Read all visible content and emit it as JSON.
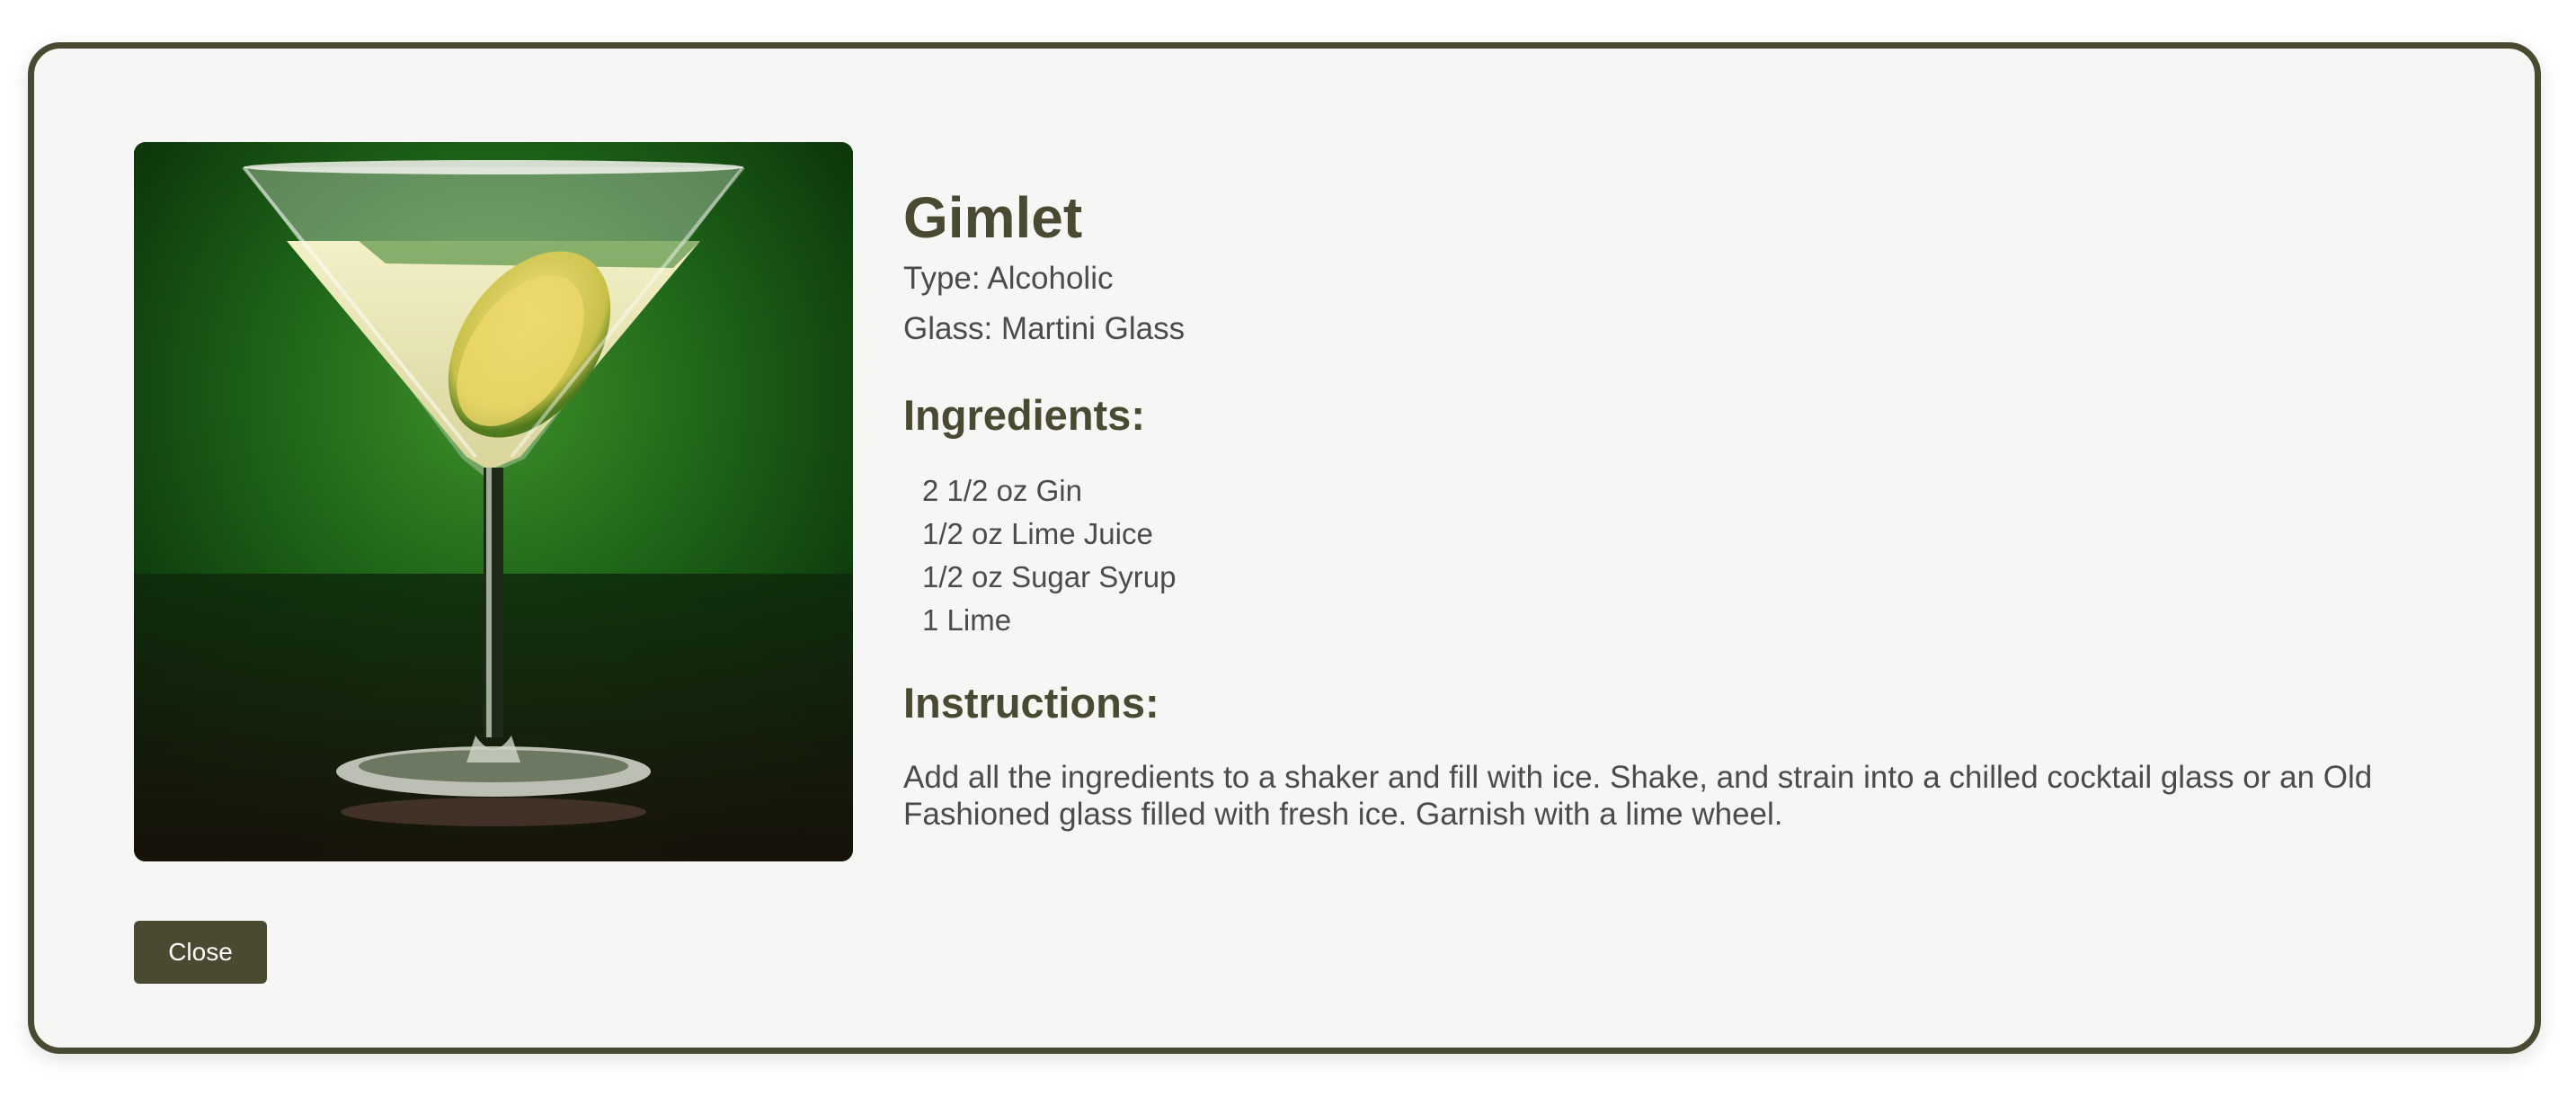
{
  "drink": {
    "name": "Gimlet",
    "type_line": "Type: Alcoholic",
    "glass_line": "Glass: Martini Glass",
    "image_alt": "Gimlet cocktail in a martini glass with a lime slice"
  },
  "ingredients_heading": "Ingredients:",
  "ingredients": [
    "2 1/2 oz Gin",
    "1/2 oz Lime Juice",
    "1/2 oz Sugar Syrup",
    "1 Lime"
  ],
  "instructions_heading": "Instructions:",
  "instructions_text": "Add all the ingredients to a shaker and fill with ice. Shake, and strain into a chilled cocktail glass or an Old Fashioned glass filled with fresh ice. Garnish with a lime wheel.",
  "close_label": "Close",
  "colors": {
    "accent": "#4a4a33",
    "panel": "#f6f6f4",
    "text": "#4b4b4b"
  }
}
